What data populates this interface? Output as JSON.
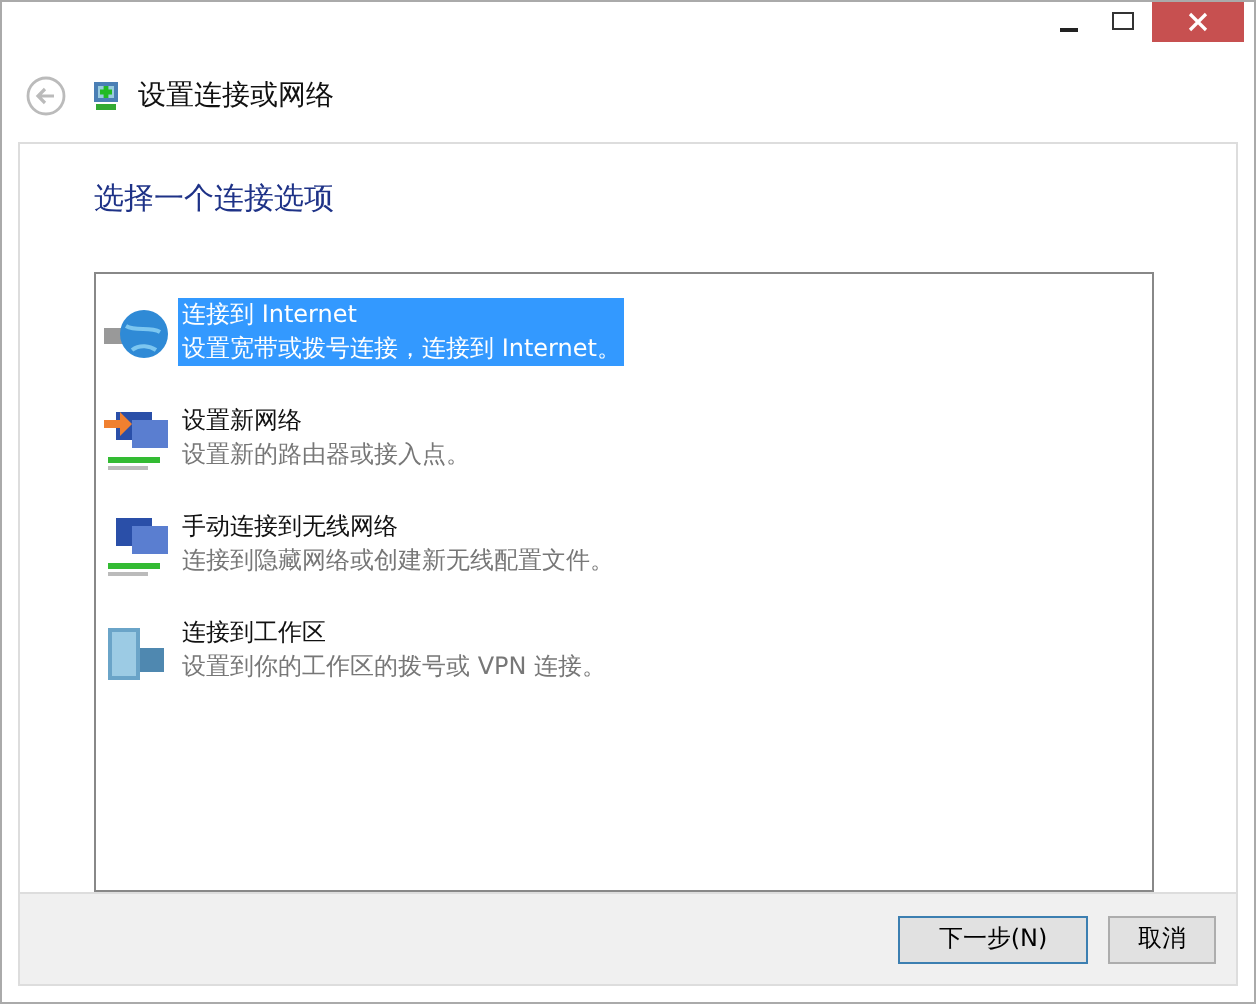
{
  "window": {
    "title": "设置连接或网络"
  },
  "heading": "选择一个连接选项",
  "options": [
    {
      "kind": "internet",
      "title": "连接到 Internet",
      "description": "设置宽带或拨号连接，连接到 Internet。",
      "selected": true
    },
    {
      "kind": "new-network",
      "title": "设置新网络",
      "description": "设置新的路由器或接入点。",
      "selected": false
    },
    {
      "kind": "wireless",
      "title": "手动连接到无线网络",
      "description": "连接到隐藏网络或创建新无线配置文件。",
      "selected": false
    },
    {
      "kind": "workplace",
      "title": "连接到工作区",
      "description": "设置到你的工作区的拨号或 VPN 连接。",
      "selected": false
    }
  ],
  "buttons": [
    {
      "label": "下一步(N)",
      "kind": "default"
    },
    {
      "label": "取消",
      "kind": "normal"
    }
  ]
}
